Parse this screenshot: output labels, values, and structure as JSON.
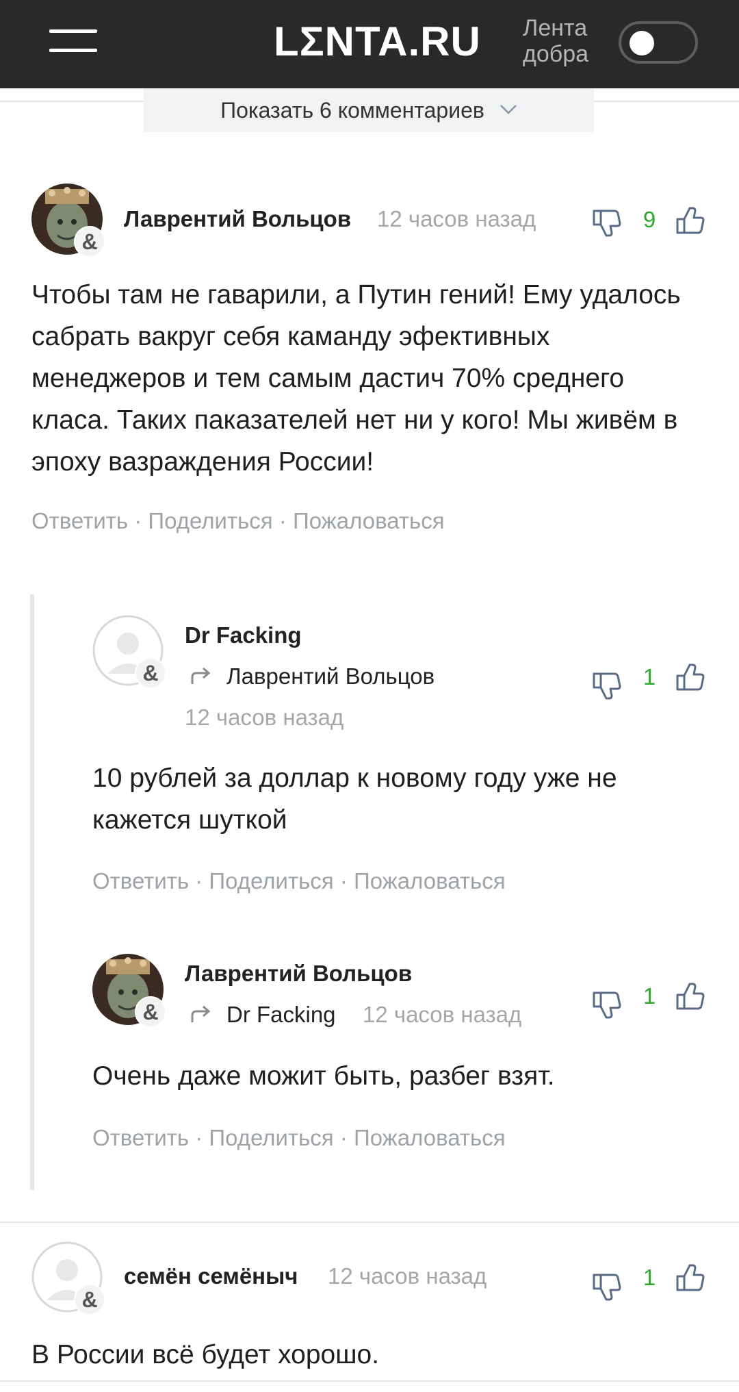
{
  "header": {
    "logo": "LΣNTA.RU",
    "kind_label_line1": "Лента",
    "kind_label_line2": "добра",
    "toggle_on": false
  },
  "show_comments": {
    "label": "Показать 6 комментариев"
  },
  "actions": {
    "reply": "Ответить",
    "share": "Поделиться",
    "report": "Пожаловаться",
    "separator": "·"
  },
  "comments": [
    {
      "author": "Лаврентий Вольцов",
      "time": "12 часов назад",
      "votes": "9",
      "text": "Чтобы там не гаварили, а Путин гений! Ему удалось сабрать вакруг себя каманду эфективных менеджеров и тем самым дастич 70% среднего класа. Таких паказателей нет ни у кого! Мы живём в эпоху вазраждения России!"
    },
    {
      "author": "Dr Facking",
      "reply_to": "Лаврентий Вольцов",
      "time": "12 часов назад",
      "votes": "1",
      "text": "10 рублей за доллар к новому году уже не кажется шуткой"
    },
    {
      "author": "Лаврентий Вольцов",
      "reply_to": "Dr Facking",
      "time": "12 часов назад",
      "votes": "1",
      "text": "Очень даже можит быть, разбег взят."
    },
    {
      "author": "семён семёныч",
      "time": "12 часов назад",
      "votes": "1",
      "text": "В России всё будет хорошо."
    }
  ],
  "colors": {
    "header_bg": "#292929",
    "vote_green": "#2fa82f",
    "muted": "#a6a6a6"
  }
}
